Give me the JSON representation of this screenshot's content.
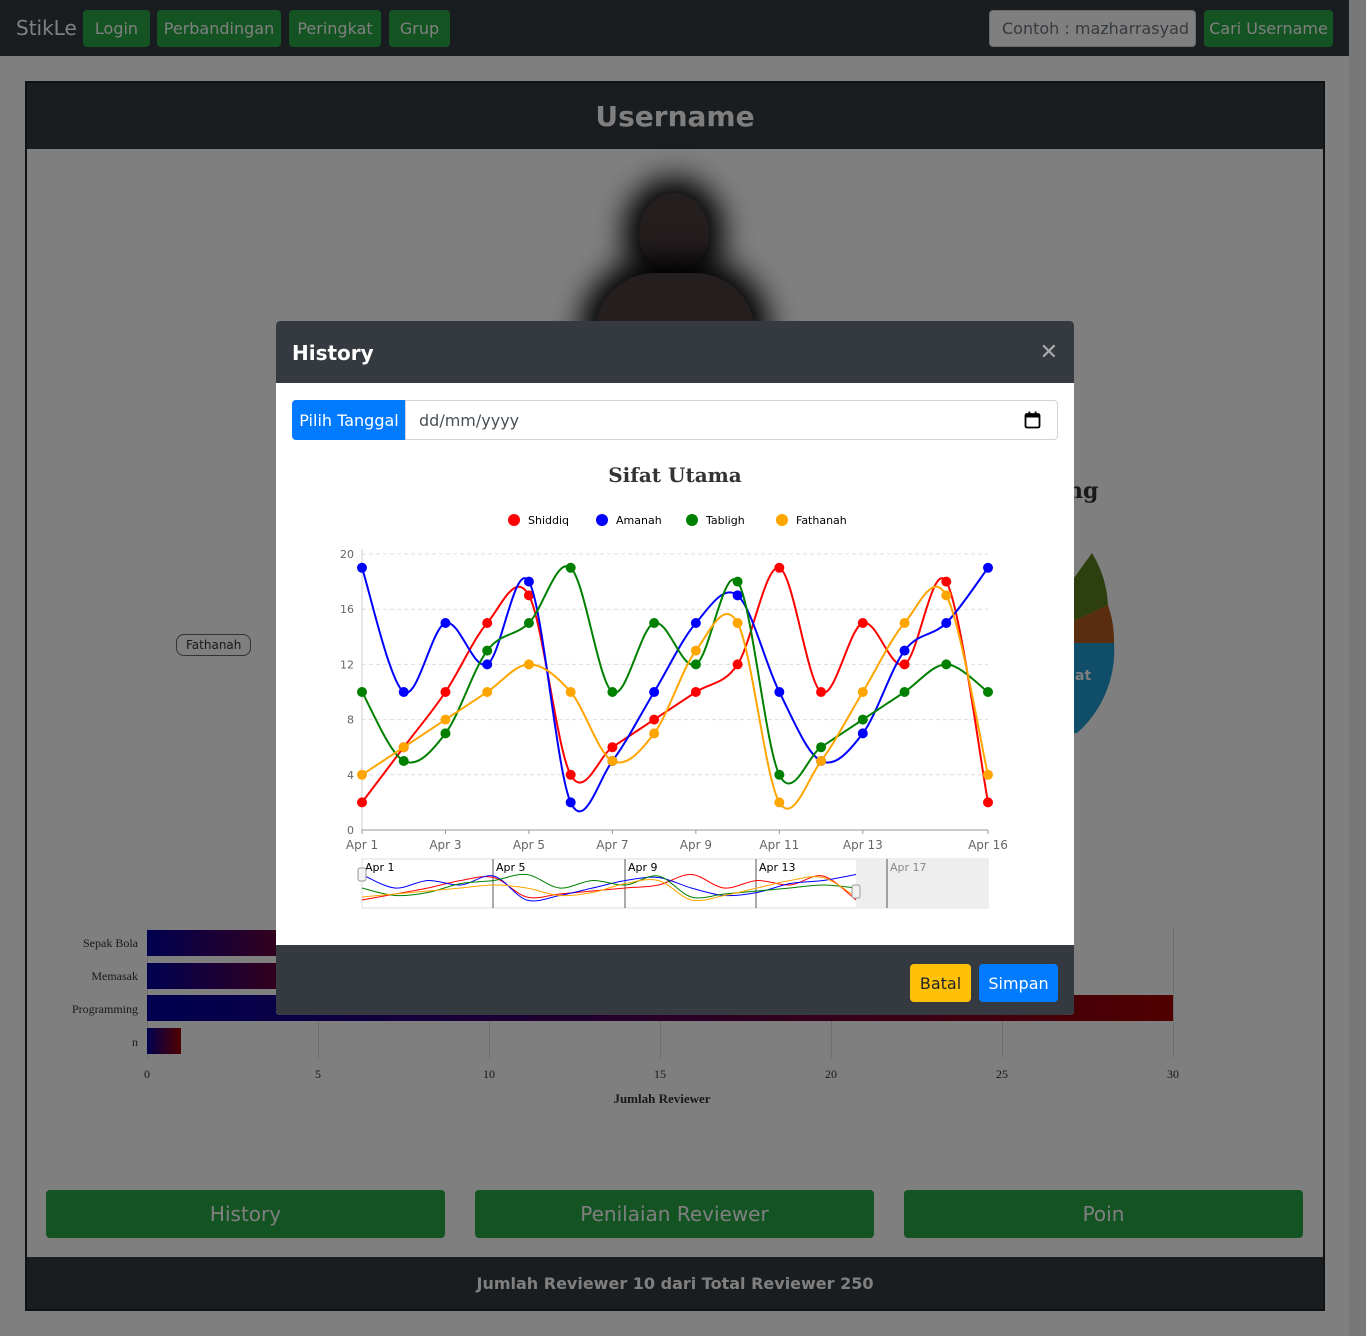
{
  "navbar": {
    "brand": "StikLe",
    "links": [
      "Login",
      "Perbandingan",
      "Peringkat",
      "Grup"
    ],
    "search_placeholder": "Contoh : mazharrasyad",
    "search_button": "Cari Username"
  },
  "profile": {
    "title": "Username",
    "pie_title_fragment": "ng",
    "pie_label_fragment": "at",
    "tooltip_label": "Fathanah",
    "bar_labels": [
      "Sepak Bola",
      "Memasak",
      "Programming",
      "n"
    ],
    "bar_values": [
      6,
      6,
      30,
      1
    ],
    "bar_ticks": [
      "0",
      "5",
      "10",
      "15",
      "20",
      "25",
      "30"
    ],
    "bar_axis_title": "Jumlah Reviewer",
    "buttons": [
      "History",
      "Penilaian Reviewer",
      "Poin"
    ],
    "footer": "Jumlah Reviewer 10 dari Total Reviewer 250"
  },
  "modal": {
    "title": "History",
    "date_button": "Pilih Tanggal",
    "date_placeholder": "dd/mm/yyyy",
    "cancel": "Batal",
    "save": "Simpan"
  },
  "colors": {
    "navbar_bg": "#343a40",
    "success": "#28a745",
    "primary": "#007bff",
    "warning": "#ffc107"
  },
  "chart_data": {
    "type": "line",
    "title": "Sifat Utama",
    "x": [
      "Apr 1",
      "Apr 2",
      "Apr 3",
      "Apr 4",
      "Apr 5",
      "Apr 6",
      "Apr 7",
      "Apr 8",
      "Apr 9",
      "Apr 10",
      "Apr 11",
      "Apr 12",
      "Apr 13",
      "Apr 14",
      "Apr 15",
      "Apr 16"
    ],
    "x_tick_labels": [
      "Apr 1",
      "Apr 3",
      "Apr 5",
      "Apr 7",
      "Apr 9",
      "Apr 11",
      "Apr 13",
      "Apr 16"
    ],
    "y_ticks": [
      0,
      4,
      8,
      12,
      16,
      20
    ],
    "ylim": [
      0,
      20
    ],
    "grid": true,
    "legend_position": "top",
    "series": [
      {
        "name": "Shiddiq",
        "color": "#ff0000",
        "values": [
          2,
          6,
          10,
          15,
          17,
          4,
          6,
          8,
          10,
          12,
          19,
          10,
          15,
          12,
          18,
          2
        ]
      },
      {
        "name": "Amanah",
        "color": "#0000ff",
        "values": [
          19,
          10,
          15,
          12,
          18,
          2,
          5,
          10,
          15,
          17,
          10,
          5,
          7,
          13,
          15,
          19
        ]
      },
      {
        "name": "Tabligh",
        "color": "#008000",
        "values": [
          10,
          5,
          7,
          13,
          15,
          19,
          10,
          15,
          12,
          18,
          4,
          6,
          8,
          10,
          12,
          10
        ]
      },
      {
        "name": "Fathanah",
        "color": "#ffa500",
        "values": [
          4,
          6,
          8,
          10,
          12,
          10,
          5,
          7,
          13,
          15,
          2,
          5,
          10,
          15,
          17,
          4
        ]
      }
    ],
    "navigator_labels": [
      "Apr 1",
      "Apr 5",
      "Apr 9",
      "Apr 13",
      "Apr 17"
    ]
  }
}
